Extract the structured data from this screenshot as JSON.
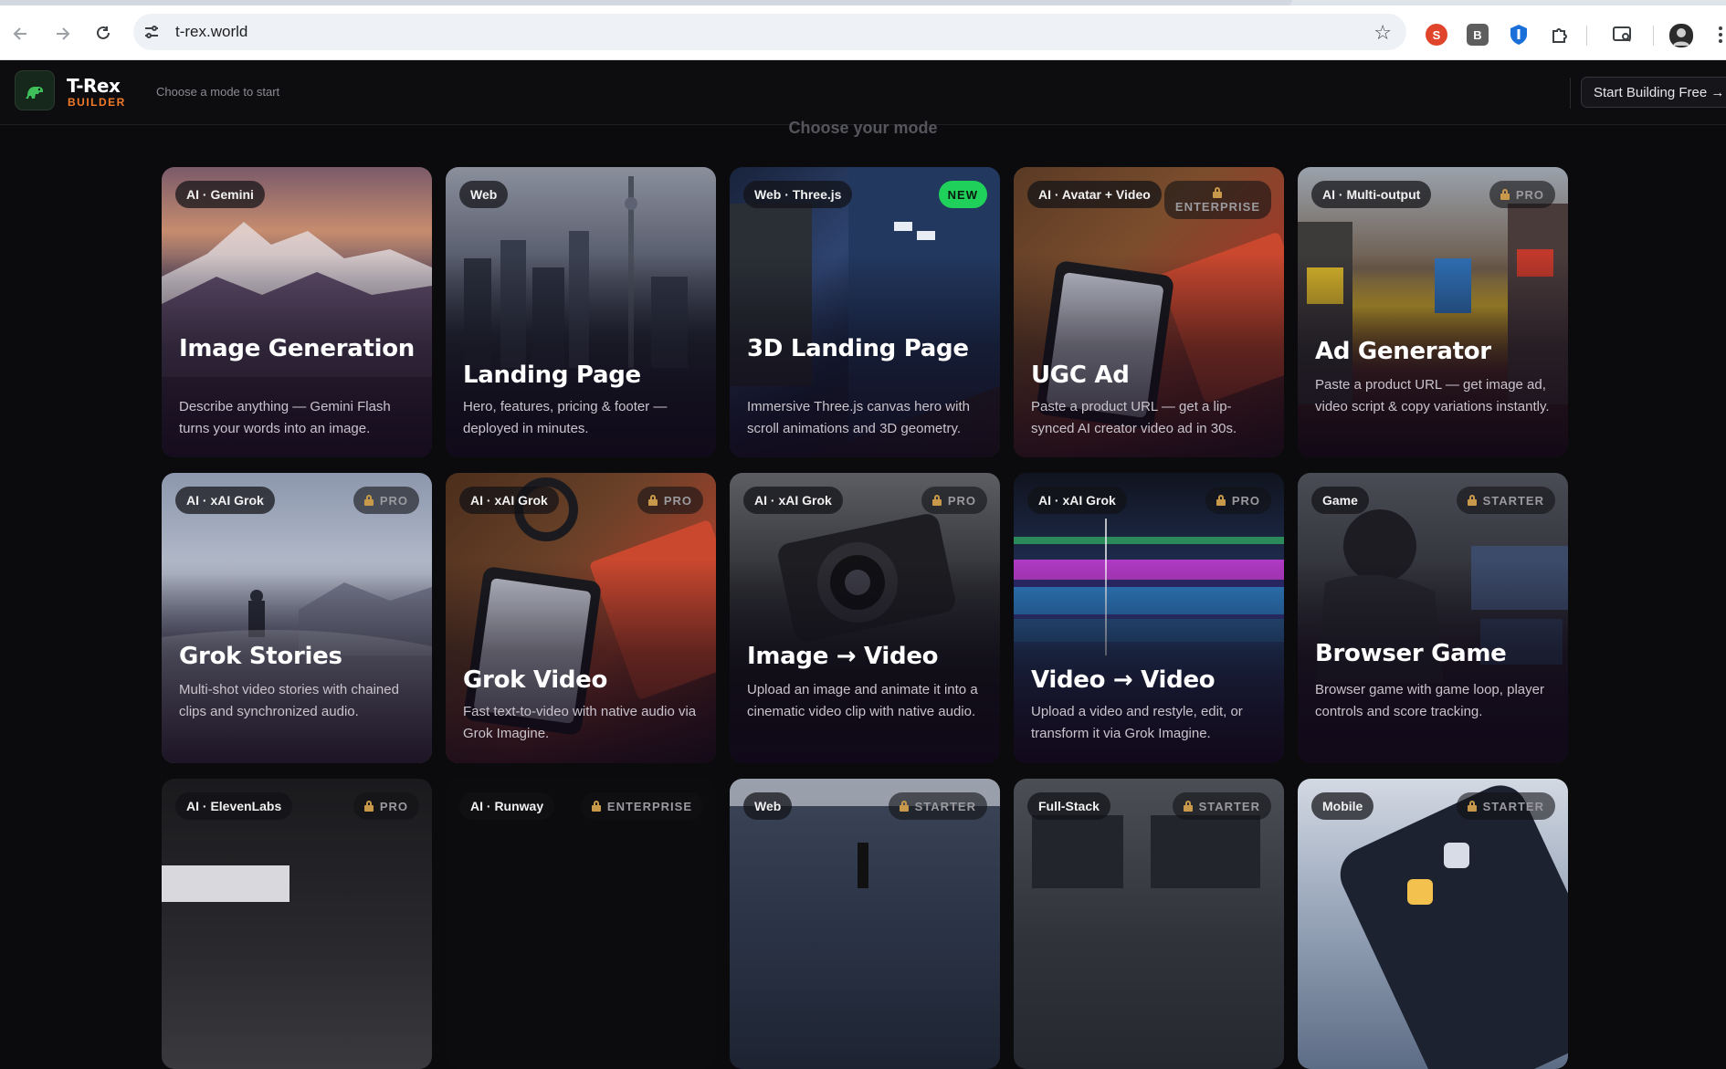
{
  "browser": {
    "url": "t-rex.world",
    "extensions": [
      {
        "name": "s-extension-icon",
        "label": "S",
        "color": "#e0452c"
      },
      {
        "name": "b-extension-icon",
        "label": "B",
        "color": "#5e5e5e"
      },
      {
        "name": "shield-extension-icon",
        "label": "",
        "color": "#1a6fd8"
      }
    ]
  },
  "header": {
    "brand": "T-Rex",
    "brand_sub": "BUILDER",
    "hint": "Choose a mode to start",
    "cta": "Start Building Free →",
    "accent": "#ef7a2a"
  },
  "section": {
    "title": "Choose your mode"
  },
  "cards": [
    {
      "badge": "AI · Gemini",
      "tier": "",
      "title": "Image Generation",
      "desc": "Describe anything — Gemini Flash turns your words into an image."
    },
    {
      "badge": "Web",
      "tier": "",
      "title": "Landing Page",
      "desc": "Hero, features, pricing & footer — deployed in minutes."
    },
    {
      "badge": "Web · Three.js",
      "tier": "NEW",
      "title": "3D Landing Page",
      "desc": "Immersive Three.js canvas hero with scroll animations and 3D geometry."
    },
    {
      "badge": "AI · Avatar + Video",
      "tier": "ENTERPRISE",
      "title": "UGC Ad",
      "desc": "Paste a product URL — get a lip-synced AI creator video ad in 30s."
    },
    {
      "badge": "AI · Multi-output",
      "tier": "PRO",
      "title": "Ad Generator",
      "desc": "Paste a product URL — get image ad, video script & copy variations instantly."
    },
    {
      "badge": "AI · xAI Grok",
      "tier": "PRO",
      "title": "Grok Stories",
      "desc": "Multi-shot video stories with chained clips and synchronized audio."
    },
    {
      "badge": "AI · xAI Grok",
      "tier": "PRO",
      "title": "Grok Video",
      "desc": "Fast text-to-video with native audio via Grok Imagine."
    },
    {
      "badge": "AI · xAI Grok",
      "tier": "PRO",
      "title": "Image → Video",
      "desc": "Upload an image and animate it into a cinematic video clip with native audio."
    },
    {
      "badge": "AI · xAI Grok",
      "tier": "PRO",
      "title": "Video → Video",
      "desc": "Upload a video and restyle, edit, or transform it via Grok Imagine."
    },
    {
      "badge": "Game",
      "tier": "STARTER",
      "title": "Browser Game",
      "desc": "Browser game with game loop, player controls and score tracking."
    },
    {
      "badge": "AI · ElevenLabs",
      "tier": "PRO",
      "title": "",
      "desc": ""
    },
    {
      "badge": "AI · Runway",
      "tier": "ENTERPRISE",
      "title": "",
      "desc": ""
    },
    {
      "badge": "Web",
      "tier": "STARTER",
      "title": "",
      "desc": ""
    },
    {
      "badge": "Full-Stack",
      "tier": "STARTER",
      "title": "",
      "desc": ""
    },
    {
      "badge": "Mobile",
      "tier": "STARTER",
      "title": "",
      "desc": ""
    }
  ]
}
